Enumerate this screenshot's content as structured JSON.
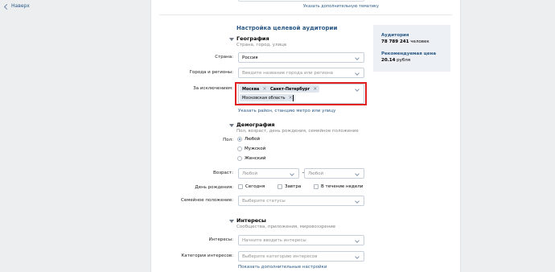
{
  "nav": {
    "up_label": "Наверх"
  },
  "top_link": "Указать дополнительную тематику",
  "audience": {
    "heading": "Настройка целевой аудитории",
    "geo": {
      "title": "География",
      "subtitle": "Страна, город, улице",
      "country_label": "Страна:",
      "country_value": "Россия",
      "cities_label": "Города и регионы:",
      "cities_placeholder": "Введите название города или региона",
      "except_label": "За исключением:",
      "except_tags": [
        "Москва",
        "Санкт-Петербург",
        "Московская область"
      ],
      "add_link": "Указать район, станцию метро или улицу"
    },
    "demo": {
      "title": "Демография",
      "subtitle": "Пол, возраст, день рождения, семейное положение",
      "sex_label": "Пол:",
      "sex_options": [
        "Любой",
        "Мужской",
        "Женский"
      ],
      "sex_selected": "Любой",
      "age_label": "Возраст:",
      "age_from": "Любой",
      "age_to": "Любой",
      "bday_label": "День рождения:",
      "bday_options": [
        "Сегодня",
        "Завтра",
        "В течение недели"
      ],
      "family_label": "Семейное положение:",
      "family_placeholder": "Выберите статусы"
    },
    "interests": {
      "title": "Интересы",
      "subtitle": "Сообщества, приложения, мировоззрение",
      "interests_label": "Интересы:",
      "interests_placeholder": "Начните вводить интересы",
      "categories_label": "Категории интересов:",
      "categories_placeholder": "Выберите категорию интересов",
      "more_link": "Показать дополнительные настройки"
    }
  },
  "sidebar": {
    "audience_title": "Аудитория",
    "audience_value": "78 789 241",
    "audience_unit": "человек",
    "price_title": "Рекомендуемая цена",
    "price_value": "20.14",
    "price_unit": "рубля"
  },
  "colors": {
    "link": "#2a5885",
    "highlight": "#e02020",
    "tag_bg": "#dfe6ee"
  }
}
